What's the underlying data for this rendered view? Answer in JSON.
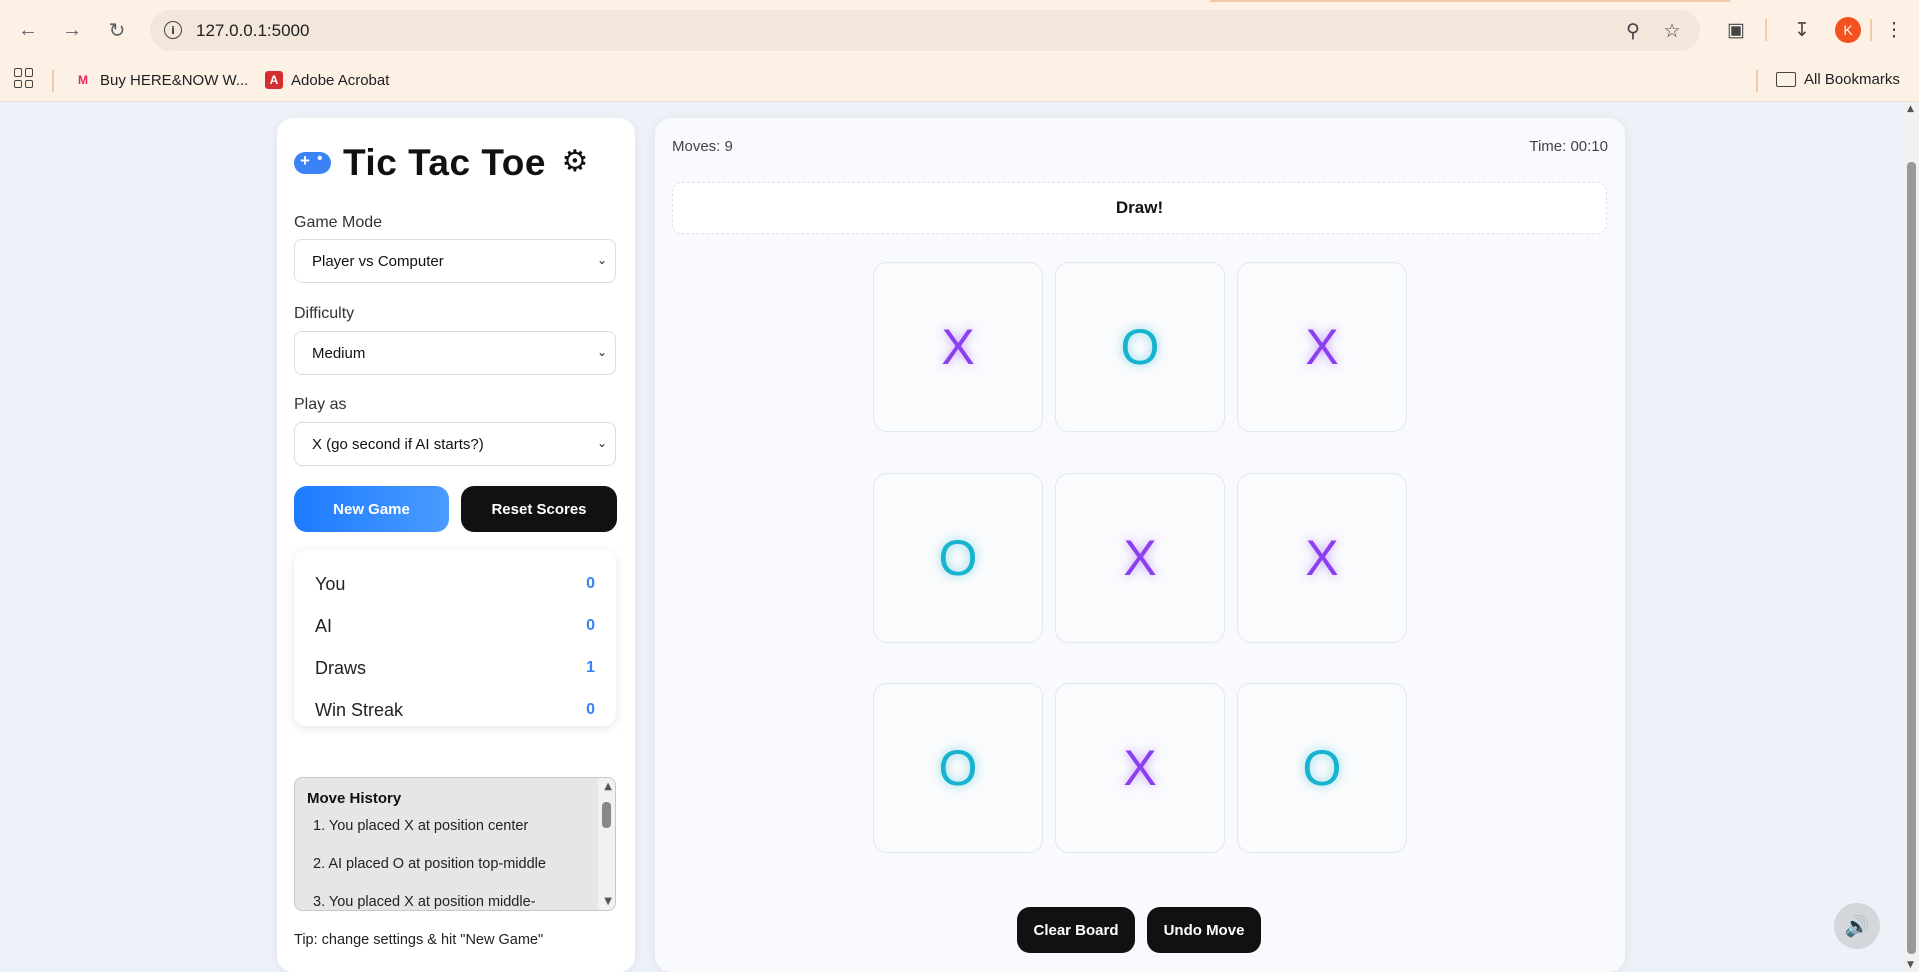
{
  "browser": {
    "url": "127.0.0.1:5000",
    "profile_initial": "K",
    "bookmarks": [
      {
        "label": "Buy HERE&NOW W...",
        "icon": "myntra-icon"
      },
      {
        "label": "Adobe Acrobat",
        "icon": "acrobat-icon"
      }
    ],
    "all_bookmarks_label": "All Bookmarks"
  },
  "sidebar": {
    "title": "Tic Tac Toe",
    "game_mode": {
      "label": "Game Mode",
      "value": "Player vs Computer"
    },
    "difficulty": {
      "label": "Difficulty",
      "value": "Medium"
    },
    "play_as": {
      "label": "Play as",
      "value": "X (go second if AI starts?)"
    },
    "new_game_label": "New Game",
    "reset_scores_label": "Reset Scores",
    "scores": [
      {
        "label": "You",
        "value": "0"
      },
      {
        "label": "AI",
        "value": "0"
      },
      {
        "label": "Draws",
        "value": "1"
      },
      {
        "label": "Win Streak",
        "value": "0"
      }
    ],
    "history": {
      "title": "Move History",
      "items": [
        "1. You placed X at position center",
        "2. AI placed O at position top-middle",
        "3. You placed X at position middle-"
      ]
    },
    "tip": "Tip: change settings & hit \"New Game\""
  },
  "game": {
    "moves": "Moves: 9",
    "time": "Time: 00:10",
    "status": "Draw!",
    "board": [
      "X",
      "O",
      "X",
      "O",
      "X",
      "X",
      "O",
      "X",
      "O"
    ],
    "clear_label": "Clear Board",
    "undo_label": "Undo Move"
  },
  "colors": {
    "accent": "#3b82f6",
    "x_mark": "#8b3ff0",
    "o_mark": "#17b4cf"
  }
}
